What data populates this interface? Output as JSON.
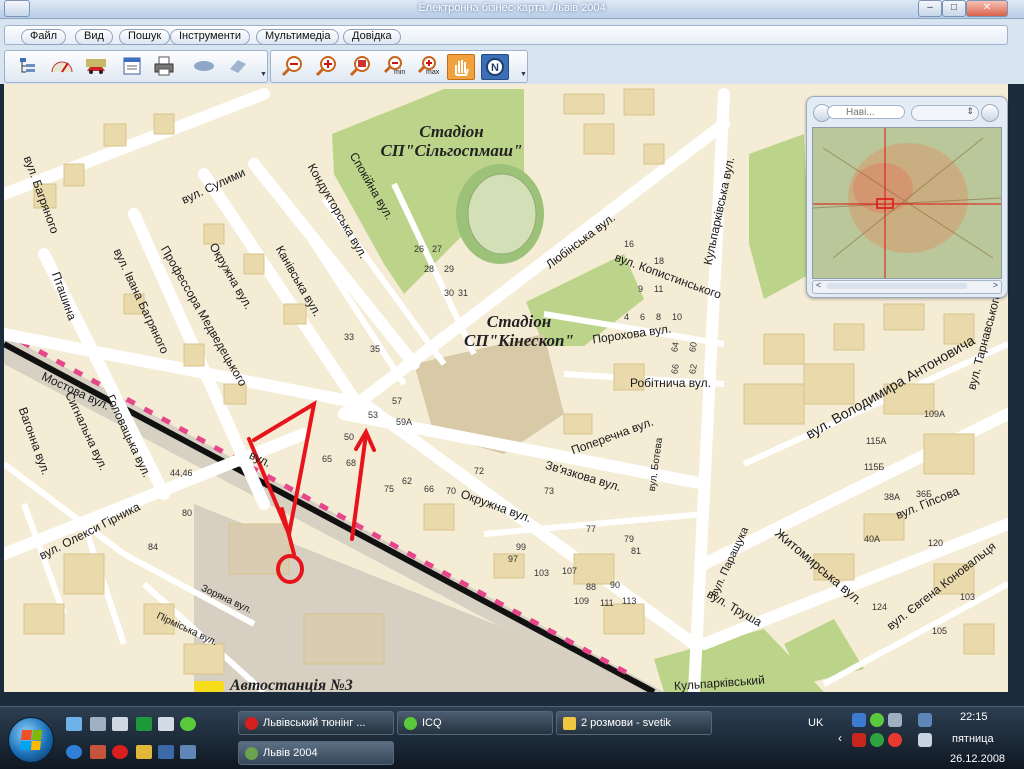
{
  "window": {
    "title": "Електронна бізнес-карта. Львів 2004",
    "controls": [
      "–",
      "□",
      "✕"
    ]
  },
  "menu": [
    "Файл",
    "Вид",
    "Пошук",
    "Інструменти",
    "Мультимедіа",
    "Довідка"
  ],
  "toolbar": {
    "tools_left": [
      "layers-icon",
      "speedometer-icon",
      "car-routing-icon",
      "list-icon",
      "print-icon",
      "eye-icon",
      "eraser-icon"
    ],
    "tools_zoom": [
      "zoom-out-icon",
      "zoom-in-icon",
      "zoom-rect-icon",
      "zoom-min-icon",
      "zoom-max-icon",
      "pan-hand-icon",
      "compass-icon"
    ],
    "min_label": "min",
    "max_label": "max"
  },
  "map": {
    "stadium1": [
      "Стадіон",
      "СП\"Сільгоспмаш\""
    ],
    "stadium2": [
      "Стадіон",
      "СП\"Кінескоп\""
    ],
    "station": "Автостанція №3",
    "streets": [
      "вул. Багряного",
      "вул.",
      "вул. Сулими",
      "Профессора Медведецького",
      "Окружна вул.",
      "Канівська вул.",
      "Кондукторська вул.",
      "Спокійна вул.",
      "Любінська вул.",
      "вул. Копистинського",
      "Кульпарківська вул.",
      "Порохова вул.",
      "Робітнича вул.",
      "Поперечна вул.",
      "вул. Ботева",
      "Зв'язкова вул.",
      "Окружна вул.",
      "вул. Володимира Антоновича",
      "вул. Гіпсова",
      "Житомирська вул.",
      "вул. Паращука",
      "вул. Труша",
      "вул. Євгена Коновальця",
      "вул. Тарнавського",
      "Мостова вул.",
      "Сигнальна вул.",
      "Вагонна вул.",
      "Головацька вул.",
      "вул. Олекси Гірника",
      "Зоряна вул.",
      "Пірміська вул.",
      "Пташина",
      "вул. Івана Багряного",
      "Кульпарківський"
    ],
    "houses": [
      "53",
      "57",
      "59А",
      "50",
      "65",
      "68",
      "75",
      "62",
      "66",
      "70",
      "72",
      "73",
      "77",
      "79",
      "81",
      "88",
      "90",
      "97",
      "99",
      "103",
      "107",
      "109",
      "111",
      "113",
      "16",
      "18",
      "9",
      "11",
      "10",
      "8",
      "6",
      "4",
      "60",
      "62",
      "64",
      "66",
      "109А",
      "115А",
      "115Б",
      "36Б",
      "38А",
      "40А",
      "120",
      "124",
      "103",
      "105",
      "80",
      "84",
      "44,46",
      "26",
      "28",
      "30",
      "27",
      "29",
      "31",
      "35",
      "33"
    ]
  },
  "navigator": {
    "placeholder": "Наві...",
    "scroll_left": "<",
    "scroll_right": ">"
  },
  "taskbar": {
    "tasks": [
      {
        "label": "Львівський тюнінг ...",
        "icon": "opera-icon"
      },
      {
        "label": "ICQ",
        "icon": "icq-icon"
      },
      {
        "label": "2 розмови - svetik",
        "icon": "chat-icon"
      },
      {
        "label": "Львів 2004",
        "icon": "map-app-icon"
      }
    ],
    "lang": "UK",
    "time": "22:15",
    "weekday": "пятница",
    "date": "26.12.2008"
  },
  "colors": {
    "map_bg": "#f5ecd6",
    "blocks": "#ead9ab",
    "greenery": "#bcd48a",
    "annotation": "#e8141b",
    "rail": "#e6468a"
  }
}
